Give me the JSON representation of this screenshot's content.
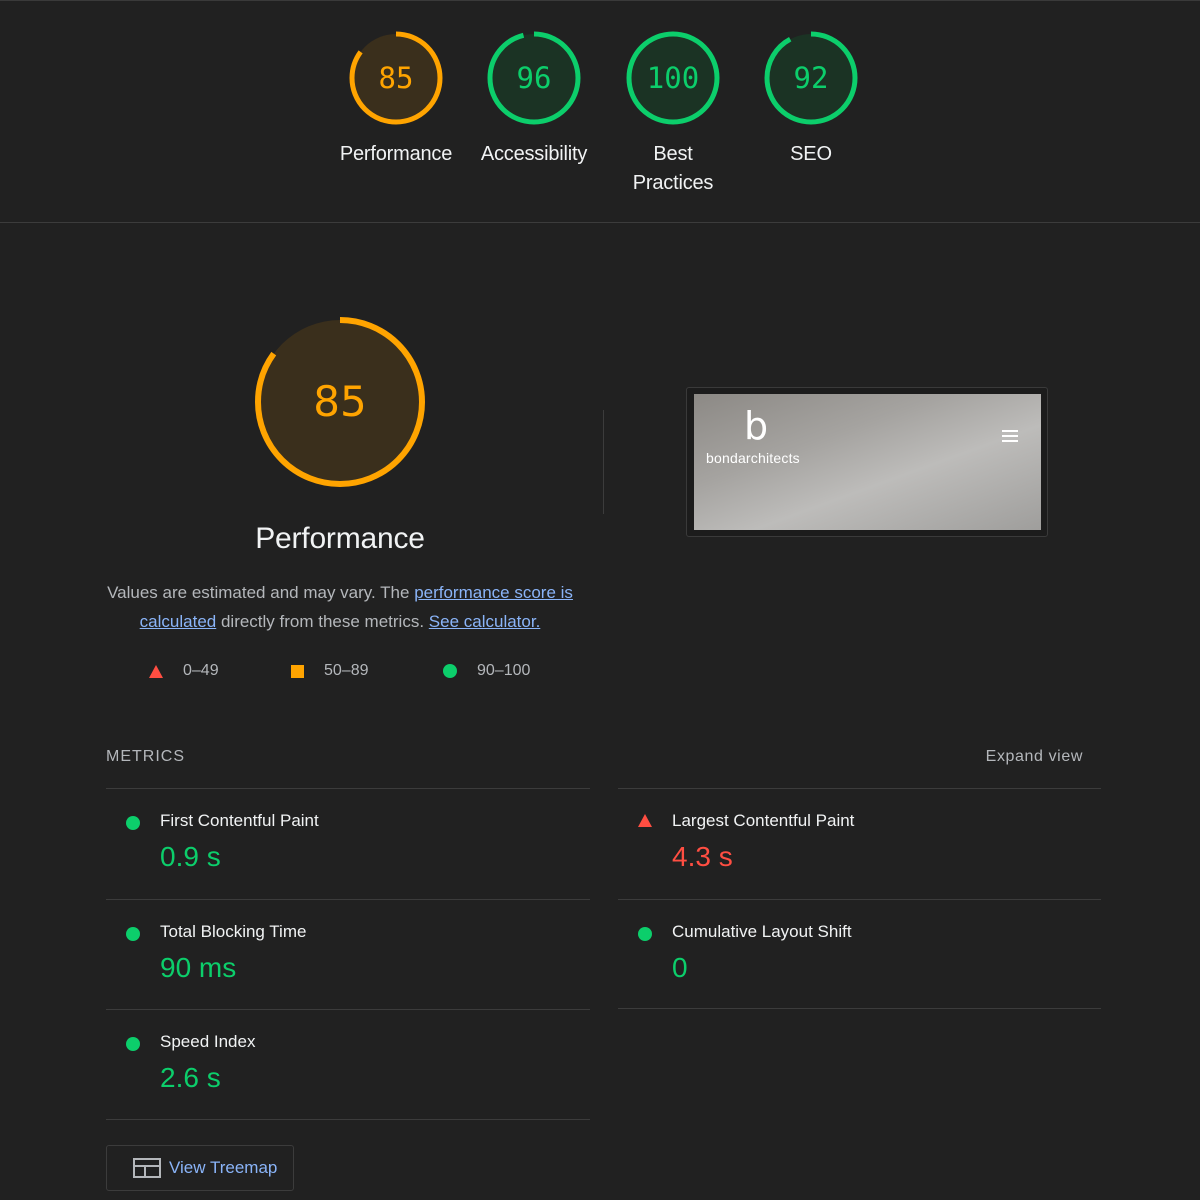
{
  "summary_scores": [
    {
      "label": "Performance",
      "score": "85",
      "value": 85,
      "color": "#ffa400",
      "bg": "#3a2f1c"
    },
    {
      "label": "Accessibility",
      "score": "96",
      "value": 96,
      "color": "#0cce6b",
      "bg": "#1b3324"
    },
    {
      "label": "Best Practices",
      "score": "100",
      "value": 100,
      "color": "#0cce6b",
      "bg": "#1b3324"
    },
    {
      "label": "SEO",
      "score": "92",
      "value": 92,
      "color": "#0cce6b",
      "bg": "#1b3324"
    }
  ],
  "performance": {
    "score": "85",
    "value": 85,
    "color": "#ffa400",
    "title": "Performance",
    "desc_prefix": "Values are estimated and may vary. The ",
    "desc_link1": "performance score is calculated",
    "desc_middle": " directly from these metrics. ",
    "desc_link2": "See calculator."
  },
  "legend": [
    {
      "shape": "triangle",
      "range": "0–49",
      "color": "#ff4e42"
    },
    {
      "shape": "square",
      "range": "50–89",
      "color": "#ffa400"
    },
    {
      "shape": "circle",
      "range": "90–100",
      "color": "#0cce6b"
    }
  ],
  "thumbnail": {
    "logo_mark": "b",
    "logo_text": "bondarchitects",
    "menu_icon": "hamburger-menu-icon"
  },
  "metrics": {
    "heading": "METRICS",
    "expand_label": "Expand view",
    "items": [
      {
        "title": "First Contentful Paint",
        "value": "0.9 s",
        "status": "pass"
      },
      {
        "title": "Largest Contentful Paint",
        "value": "4.3 s",
        "status": "fail"
      },
      {
        "title": "Total Blocking Time",
        "value": "90 ms",
        "status": "pass"
      },
      {
        "title": "Cumulative Layout Shift",
        "value": "0",
        "status": "pass"
      },
      {
        "title": "Speed Index",
        "value": "2.6 s",
        "status": "pass"
      }
    ]
  },
  "treemap_button": {
    "label": "View Treemap",
    "icon": "treemap-icon"
  },
  "colors": {
    "pass": "#0cce6b",
    "average": "#ffa400",
    "fail": "#ff4e42",
    "link": "#8ab4f8",
    "background": "#212121"
  }
}
